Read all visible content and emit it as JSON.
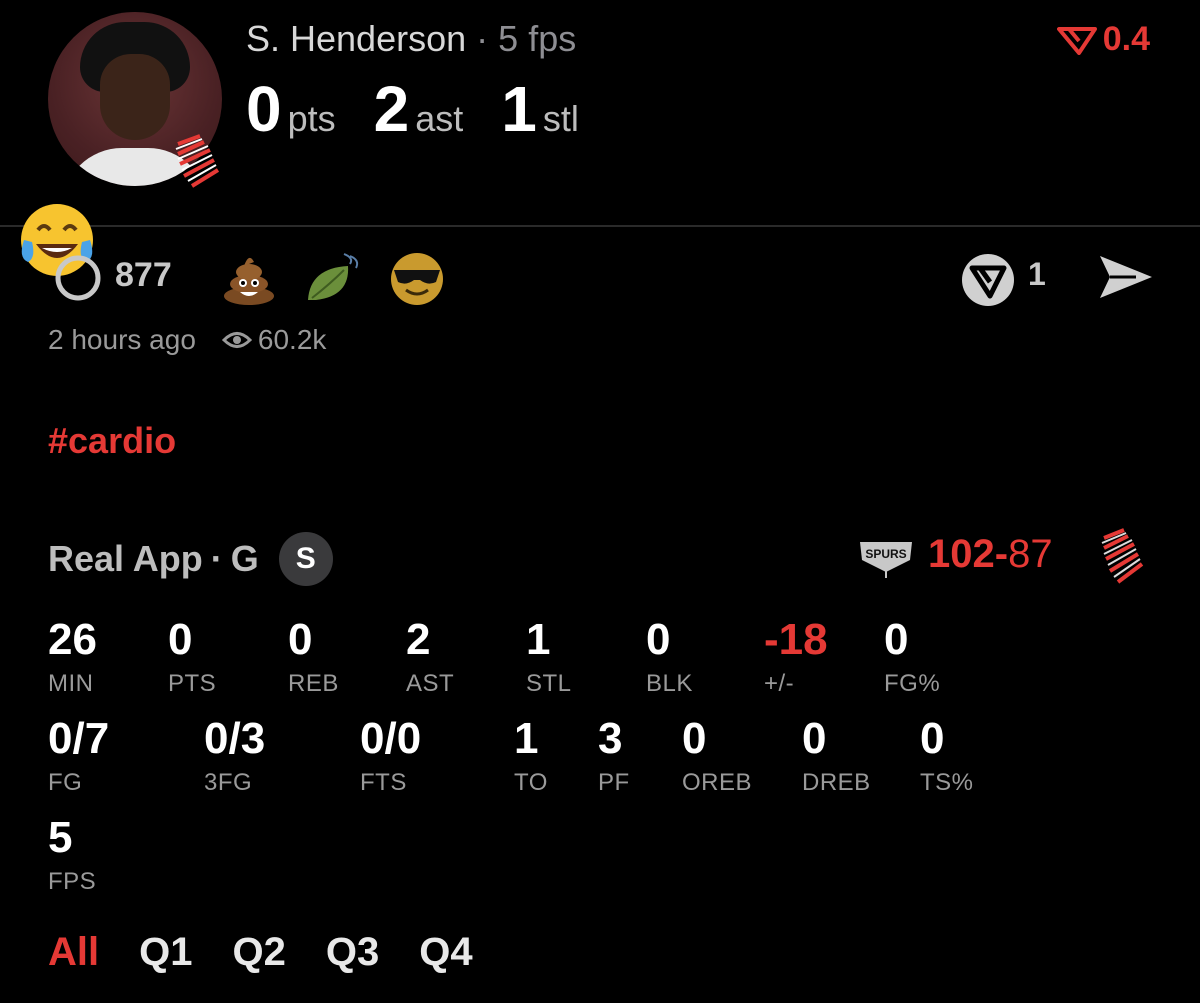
{
  "player": {
    "name": "S. Henderson",
    "dot": "·",
    "fps": "5 fps",
    "pts_value": "0",
    "pts_unit": "pts",
    "ast_value": "2",
    "ast_unit": "ast",
    "stl_value": "1",
    "stl_unit": "stl",
    "avatar_icon": "player-headshot",
    "team_icon": "trail-blazers-logo"
  },
  "trend": {
    "value": "0.4",
    "icon": "down-trend-icon",
    "color": "#e53935"
  },
  "reactions": {
    "floating_emoji": "laughing-tears-emoji",
    "comment_count": "877",
    "items": [
      "poop-emoji",
      "leaf-wind-emoji",
      "sunglasses-emoji"
    ],
    "vote_count": "1",
    "vote_icon": "real-app-vote-icon",
    "share_icon": "send-icon"
  },
  "meta": {
    "time": "2 hours ago",
    "views": "60.2k"
  },
  "hashtag": "#cardio",
  "game": {
    "app": "Real App",
    "sep": "·",
    "position": "G",
    "badge": "S",
    "home_score": "102",
    "dash": "-",
    "away_score": "87",
    "home_team_icon": "spurs-logo",
    "away_team_icon": "trail-blazers-logo"
  },
  "stats": {
    "min": {
      "value": "26",
      "label": "MIN"
    },
    "pts": {
      "value": "0",
      "label": "PTS"
    },
    "reb": {
      "value": "0",
      "label": "REB"
    },
    "ast": {
      "value": "2",
      "label": "AST"
    },
    "stl": {
      "value": "1",
      "label": "STL"
    },
    "blk": {
      "value": "0",
      "label": "BLK"
    },
    "pm": {
      "value": "-18",
      "label": "+/-"
    },
    "fgp": {
      "value": "0",
      "label": "FG%"
    },
    "fg": {
      "value": "0/7",
      "label": "FG"
    },
    "fg3": {
      "value": "0/3",
      "label": "3FG"
    },
    "fts": {
      "value": "0/0",
      "label": "FTS"
    },
    "to": {
      "value": "1",
      "label": "TO"
    },
    "pf": {
      "value": "3",
      "label": "PF"
    },
    "oreb": {
      "value": "0",
      "label": "OREB"
    },
    "dreb": {
      "value": "0",
      "label": "DREB"
    },
    "tsp": {
      "value": "0",
      "label": "TS%"
    },
    "fps": {
      "value": "5",
      "label": "FPS"
    }
  },
  "tabs": [
    "All",
    "Q1",
    "Q2",
    "Q3",
    "Q4"
  ],
  "colors": {
    "accent": "#e53935",
    "background": "#000000",
    "muted": "#9a9a9a"
  }
}
